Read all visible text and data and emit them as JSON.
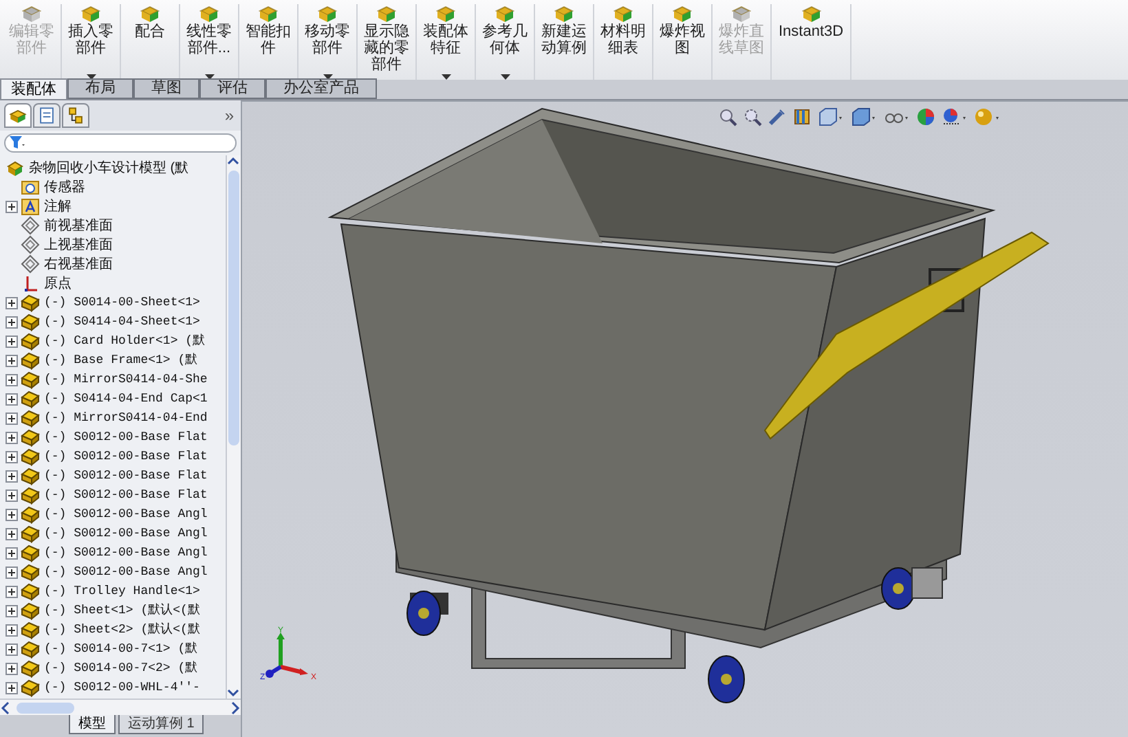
{
  "toolbar": {
    "buttons": [
      {
        "label": "编辑零部件",
        "disabled": true,
        "dropdown": false
      },
      {
        "label": "插入零部件",
        "disabled": false,
        "dropdown": true
      },
      {
        "label": "配合",
        "disabled": false,
        "dropdown": false
      },
      {
        "label": "线性零部件...",
        "disabled": false,
        "dropdown": true
      },
      {
        "label": "智能扣件",
        "disabled": false,
        "dropdown": false
      },
      {
        "label": "移动零部件",
        "disabled": false,
        "dropdown": true
      },
      {
        "label": "显示隐藏的零部件",
        "disabled": false,
        "dropdown": false
      },
      {
        "label": "装配体特征",
        "disabled": false,
        "dropdown": true
      },
      {
        "label": "参考几何体",
        "disabled": false,
        "dropdown": true
      },
      {
        "label": "新建运动算例",
        "disabled": false,
        "dropdown": false
      },
      {
        "label": "材料明细表",
        "disabled": false,
        "dropdown": false
      },
      {
        "label": "爆炸视图",
        "disabled": false,
        "dropdown": false
      },
      {
        "label": "爆炸直线草图",
        "disabled": true,
        "dropdown": false
      },
      {
        "label": "Instant3D",
        "disabled": false,
        "dropdown": false
      }
    ]
  },
  "tabs": [
    {
      "label": "装配体",
      "selected": true
    },
    {
      "label": "布局",
      "selected": false
    },
    {
      "label": "草图",
      "selected": false
    },
    {
      "label": "评估",
      "selected": false
    },
    {
      "label": "办公室产品",
      "selected": false
    }
  ],
  "panel": {
    "collapse": "»",
    "tree": [
      {
        "kind": "assembly",
        "label": "杂物回收小车设计模型 (默",
        "expandable": false
      },
      {
        "kind": "sensor",
        "label": "传感器",
        "expandable": false
      },
      {
        "kind": "annotation",
        "label": "注解",
        "expandable": true
      },
      {
        "kind": "plane",
        "label": "前视基准面",
        "expandable": false
      },
      {
        "kind": "plane",
        "label": "上视基准面",
        "expandable": false
      },
      {
        "kind": "plane",
        "label": "右视基准面",
        "expandable": false
      },
      {
        "kind": "origin",
        "label": "原点",
        "expandable": false
      },
      {
        "kind": "part",
        "label": "(-) S0014-00-Sheet<1>",
        "expandable": true
      },
      {
        "kind": "part",
        "label": "(-) S0414-04-Sheet<1>",
        "expandable": true
      },
      {
        "kind": "part",
        "label": "(-) Card Holder<1> (默",
        "expandable": true
      },
      {
        "kind": "part",
        "label": "(-) Base Frame<1> (默",
        "expandable": true
      },
      {
        "kind": "part",
        "label": "(-) MirrorS0414-04-She",
        "expandable": true
      },
      {
        "kind": "part",
        "label": "(-) S0414-04-End Cap<1",
        "expandable": true
      },
      {
        "kind": "part",
        "label": "(-) MirrorS0414-04-End",
        "expandable": true
      },
      {
        "kind": "part",
        "label": "(-) S0012-00-Base Flat",
        "expandable": true
      },
      {
        "kind": "part",
        "label": "(-) S0012-00-Base Flat",
        "expandable": true
      },
      {
        "kind": "part",
        "label": "(-) S0012-00-Base Flat",
        "expandable": true
      },
      {
        "kind": "part",
        "label": "(-) S0012-00-Base Flat",
        "expandable": true
      },
      {
        "kind": "part",
        "label": "(-) S0012-00-Base Angl",
        "expandable": true
      },
      {
        "kind": "part",
        "label": "(-) S0012-00-Base Angl",
        "expandable": true
      },
      {
        "kind": "part",
        "label": "(-) S0012-00-Base Angl",
        "expandable": true
      },
      {
        "kind": "part",
        "label": "(-) S0012-00-Base Angl",
        "expandable": true
      },
      {
        "kind": "part",
        "label": "(-) Trolley Handle<1>",
        "expandable": true
      },
      {
        "kind": "part",
        "label": "(-) Sheet<1> (默认<(默",
        "expandable": true
      },
      {
        "kind": "part",
        "label": "(-) Sheet<2> (默认<(默",
        "expandable": true
      },
      {
        "kind": "part",
        "label": "(-) S0014-00-7<1> (默",
        "expandable": true
      },
      {
        "kind": "part",
        "label": "(-) S0014-00-7<2> (默",
        "expandable": true
      },
      {
        "kind": "part",
        "label": "(-) S0012-00-WHL-4''-",
        "expandable": true
      }
    ]
  },
  "axes": {
    "x": "X",
    "y": "Y",
    "z": "Z"
  },
  "bottom_tabs": [
    {
      "label": "模型",
      "selected": true
    },
    {
      "label": "运动算例 1",
      "selected": false
    }
  ]
}
